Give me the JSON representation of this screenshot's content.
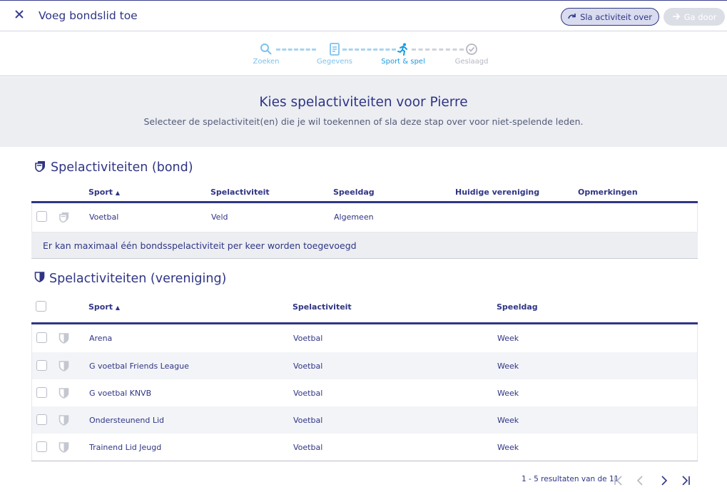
{
  "header": {
    "title": "Voeg bondslid toe",
    "skip_label": "Sla activiteit over",
    "next_label": "Ga door"
  },
  "stepper": {
    "steps": [
      {
        "label": "Zoeken",
        "state": "done"
      },
      {
        "label": "Gegevens",
        "state": "done"
      },
      {
        "label": "Sport & spel",
        "state": "active"
      },
      {
        "label": "Geslaagd",
        "state": "pending"
      }
    ]
  },
  "intro": {
    "heading": "Kies spelactiviteiten voor Pierre",
    "subtext": "Selecteer de spelactiviteit(en) die je wil toekennen of sla deze stap over voor niet-spelende leden."
  },
  "bond": {
    "title": "Spelactiviteiten (bond)",
    "columns": [
      "Sport",
      "Spelactiviteit",
      "Speeldag",
      "Huidige vereniging",
      "Opmerkingen"
    ],
    "rows": [
      {
        "sport": "Voetbal",
        "activity": "Veld",
        "day": "Algemeen",
        "club": "",
        "remarks": ""
      }
    ],
    "notice": "Er kan maximaal één bondsspelactiviteit per keer worden toegevoegd"
  },
  "club": {
    "title": "Spelactiviteiten (vereniging)",
    "columns": [
      "Sport",
      "Spelactiviteit",
      "Speeldag"
    ],
    "rows": [
      {
        "sport": "Arena",
        "activity": "Voetbal",
        "day": "Week"
      },
      {
        "sport": "G voetbal Friends League",
        "activity": "Voetbal",
        "day": "Week"
      },
      {
        "sport": "G voetbal KNVB",
        "activity": "Voetbal",
        "day": "Week"
      },
      {
        "sport": "Ondersteunend Lid",
        "activity": "Voetbal",
        "day": "Week"
      },
      {
        "sport": "Trainend Lid Jeugd",
        "activity": "Voetbal",
        "day": "Week"
      }
    ]
  },
  "pagination": {
    "summary": "1 - 5 resultaten van de 11"
  },
  "colors": {
    "primary": "#2f3584",
    "step_active": "#1a9be0",
    "step_done": "#7cc3ee",
    "step_pending": "#b5b8c2",
    "band": "#eceef2"
  }
}
